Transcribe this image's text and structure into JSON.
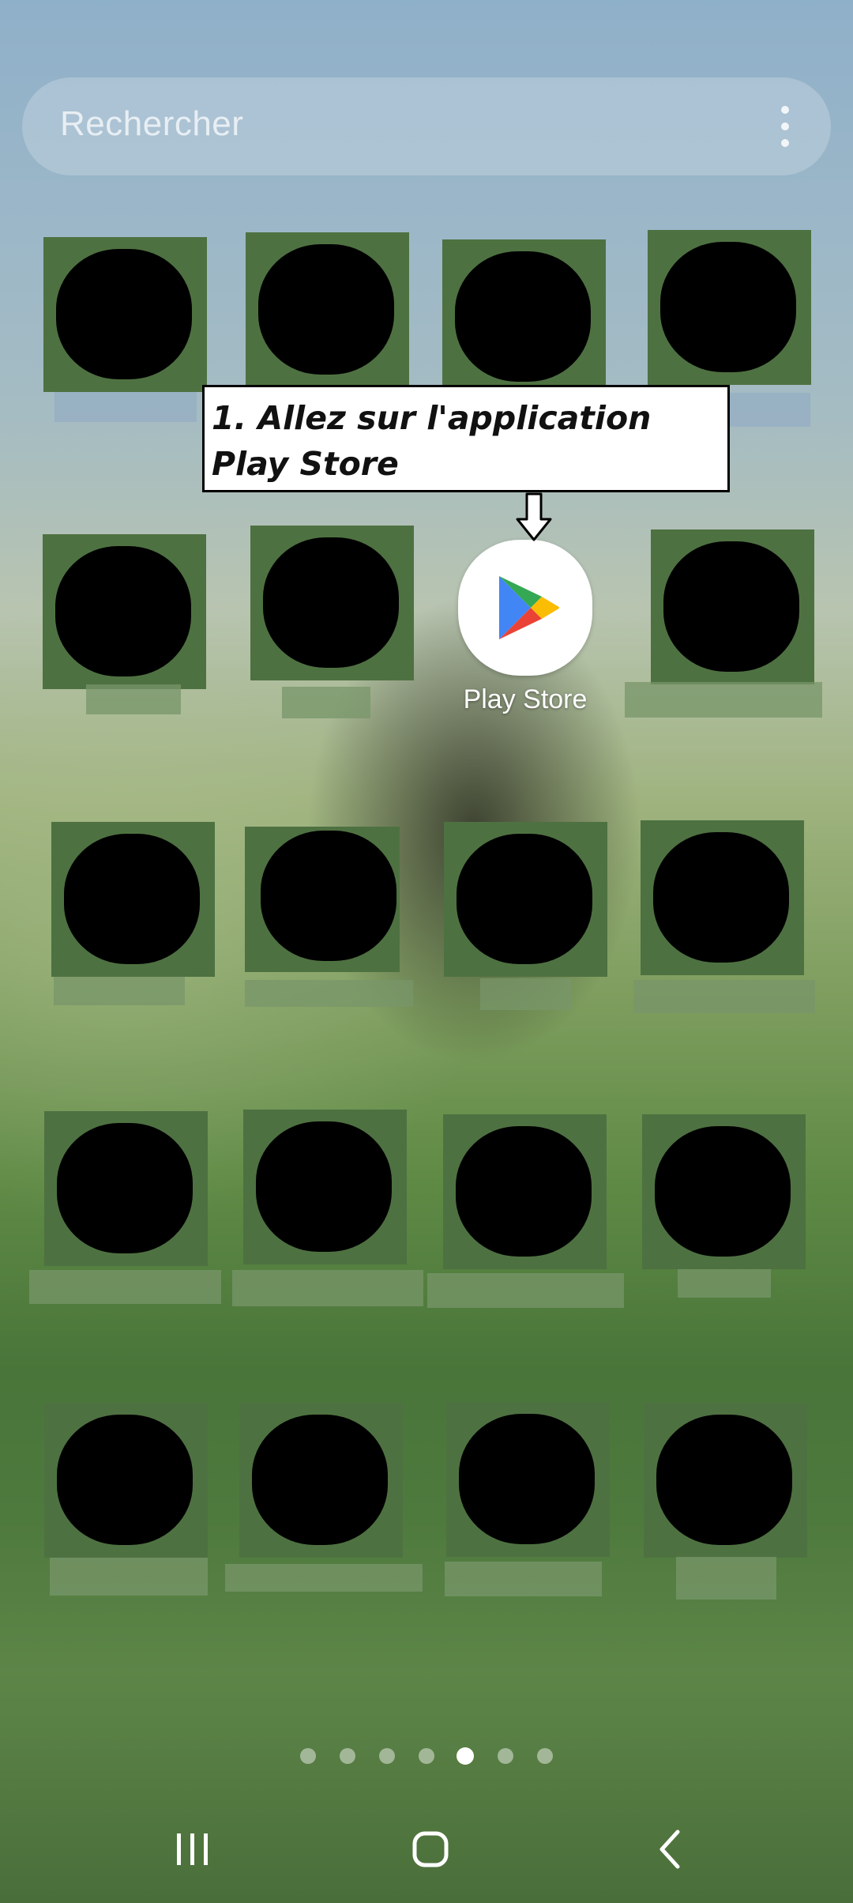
{
  "search": {
    "placeholder": "Rechercher",
    "menu_icon": "more-vertical-icon"
  },
  "callout": {
    "text": "1. Allez sur l'application Play Store"
  },
  "play_store": {
    "label": "Play Store",
    "icon": "play-store-icon"
  },
  "page_indicator": {
    "total": 7,
    "active_index": 4
  },
  "nav": {
    "recents_icon": "recents-icon",
    "home_icon": "home-icon",
    "back_icon": "back-icon"
  }
}
